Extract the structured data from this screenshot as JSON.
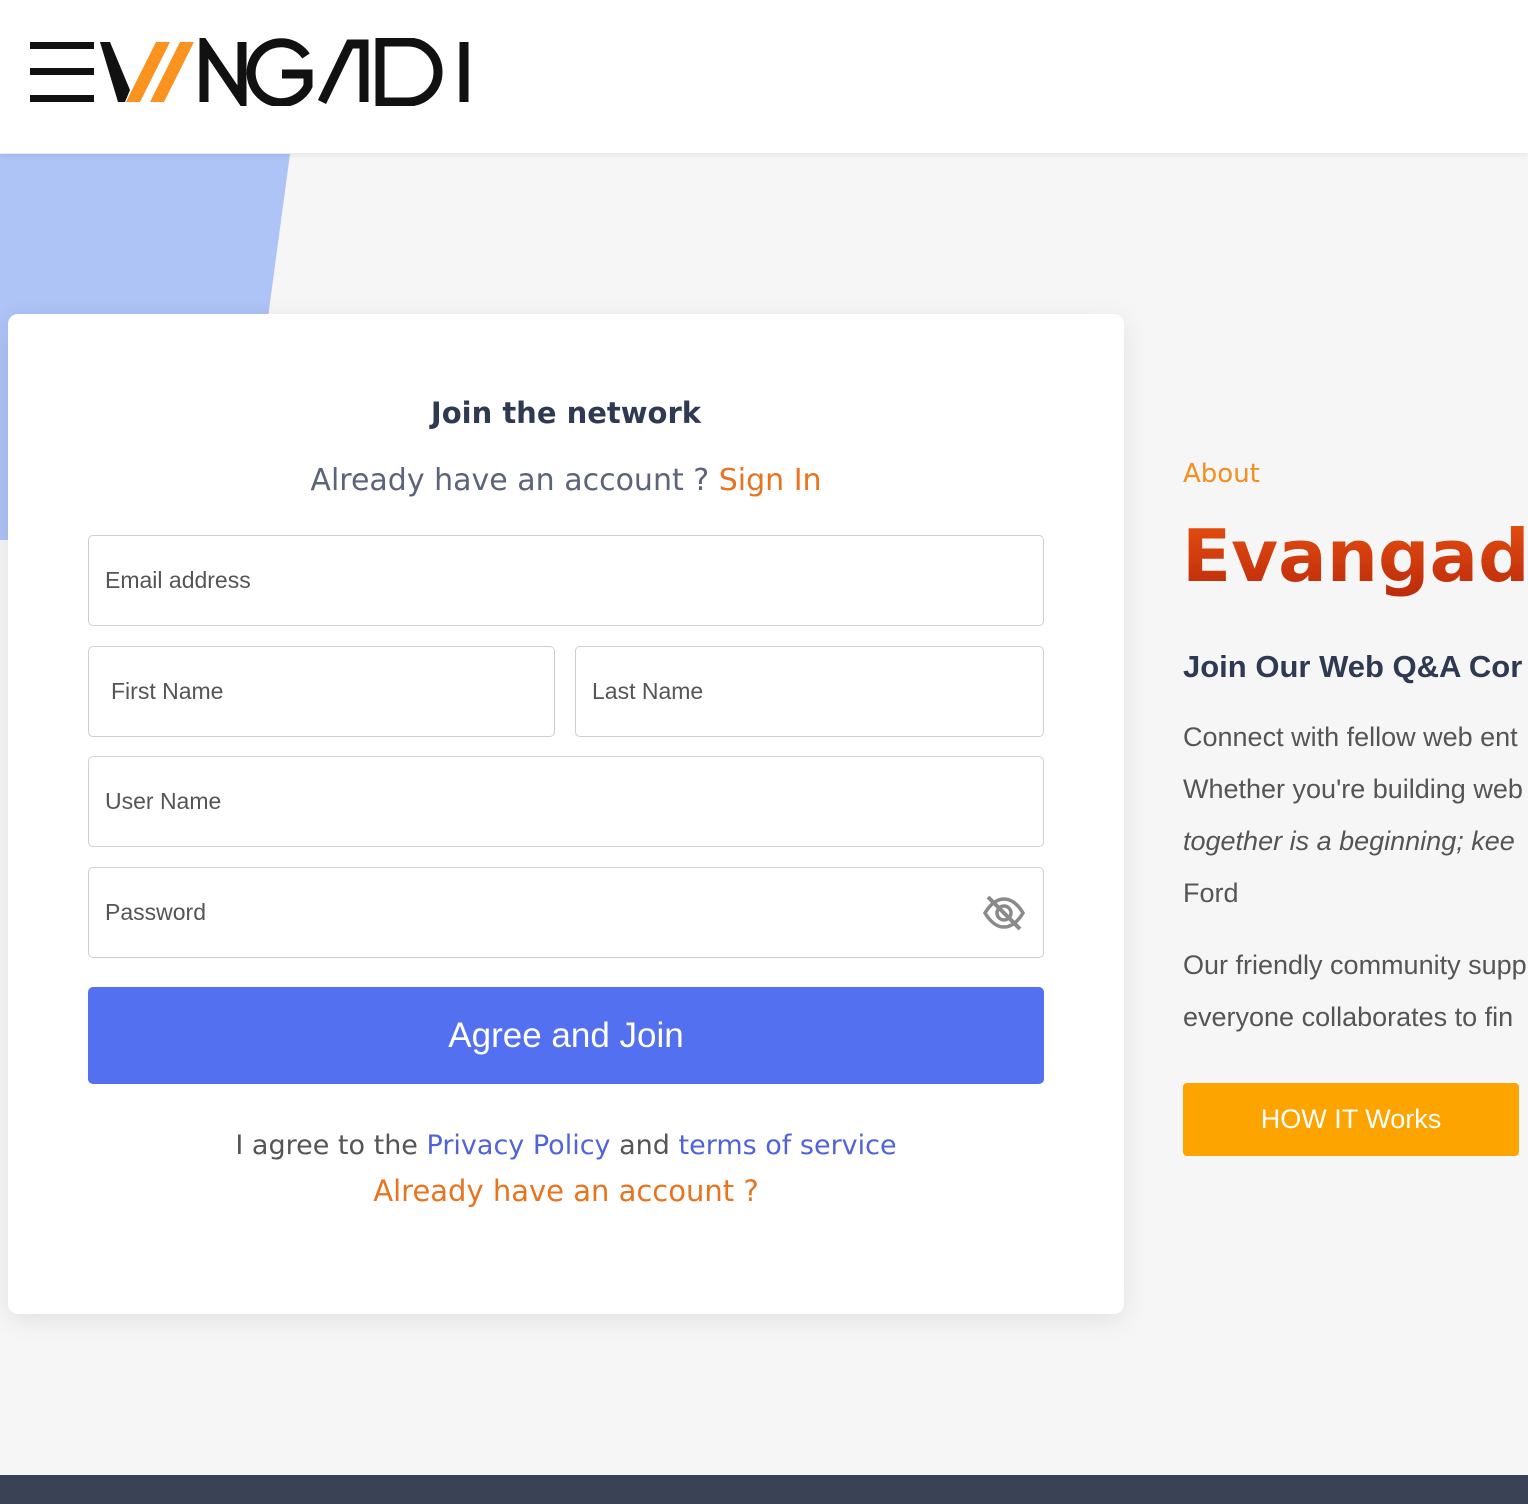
{
  "header": {
    "logo_text": "EVANGADI",
    "logo_accent_color": "#f7931e"
  },
  "signup": {
    "title": "Join the network",
    "signin_prompt": "Already have an account ?",
    "signin_link": "Sign In",
    "fields": {
      "email_placeholder": "Email address",
      "first_name_placeholder": "First Name",
      "last_name_placeholder": "Last Name",
      "username_placeholder": "User Name",
      "password_placeholder": "Password"
    },
    "password_toggle_icon": "eye-slash-icon",
    "submit_label": "Agree and Join",
    "agree_prefix": "I agree to the",
    "privacy_link": "Privacy Policy",
    "and_text": "and",
    "terms_link": "terms of service",
    "already_account_link": "Already have an account ?"
  },
  "about": {
    "label": "About",
    "title": "Evangadi",
    "subtitle": "Join Our Web Q&A Cor",
    "para1_line1": "Connect with fellow web ent",
    "para1_line2": "Whether you're building web",
    "para1_line3": "together is a beginning; kee",
    "para1_line4": "Ford",
    "para2_line1": "Our friendly community supp",
    "para2_line2": "everyone collaborates to fin",
    "button_label": "HOW IT Works"
  },
  "colors": {
    "primary_button": "#5370f0",
    "accent_orange": "#e8741f",
    "how_button": "#fea400",
    "footer": "#3a4356"
  }
}
